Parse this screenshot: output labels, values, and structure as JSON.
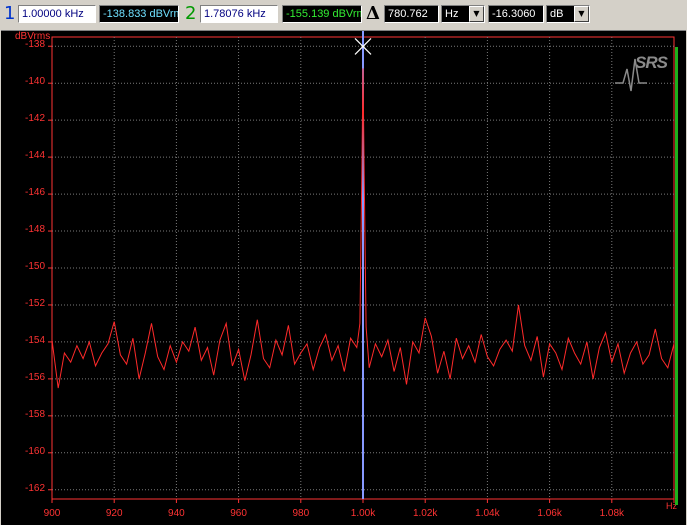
{
  "toolbar": {
    "marker1_number": "1",
    "marker1_freq": "1.00000 kHz",
    "marker1_level": "-138.833 dBVrms",
    "marker2_number": "2",
    "marker2_freq": "1.78076 kHz",
    "marker2_level": "-155.139 dBVrms",
    "delta_symbol": "Δ",
    "delta_freq": "780.762",
    "delta_freq_unit": "Hz",
    "delta_level": "-16.3060",
    "delta_level_unit": "dB",
    "dropdown_icon": "▼"
  },
  "plot": {
    "unit_label": "dBVrms",
    "x_unit_label": "Hz",
    "logo": "SRS",
    "colors": {
      "trace": "#ff2a2a",
      "grid": "#7a7a7a",
      "cursor": "#8899ff",
      "axis_text": "#ff3333",
      "marker2": "#1db11d"
    }
  },
  "chart_data": {
    "type": "line",
    "xlabel": "Hz",
    "ylabel": "dBVrms",
    "xlim": [
      900,
      1100
    ],
    "ylim": [
      -162.5,
      -137.5
    ],
    "x_tick_values": [
      900,
      920,
      940,
      960,
      980,
      1000,
      1020,
      1040,
      1060,
      1080,
      1100
    ],
    "x_tick_labels": [
      "900",
      "920",
      "940",
      "960",
      "980",
      "1.00k",
      "1.02k",
      "1.04k",
      "1.06k",
      "1.08k",
      "Hz"
    ],
    "y_tick_values": [
      -138,
      -140,
      -142,
      -144,
      -146,
      -148,
      -150,
      -152,
      -154,
      -156,
      -158,
      -160,
      -162
    ],
    "y_tick_labels": [
      "-138",
      "-140",
      "-142",
      "-144",
      "-146",
      "-148",
      "-150",
      "-152",
      "-154",
      "-156",
      "-158",
      "-160",
      "-162"
    ],
    "grid": true,
    "cursor_x": 1000,
    "marker1": {
      "x": 1000,
      "y": -139.2
    },
    "series": [
      {
        "x": [
          900,
          902,
          904,
          906,
          908,
          910,
          912,
          914,
          916,
          918,
          920,
          922,
          924,
          926,
          928,
          930,
          932,
          934,
          936,
          938,
          940,
          942,
          944,
          946,
          948,
          950,
          952,
          954,
          956,
          958,
          960,
          962,
          964,
          966,
          968,
          970,
          972,
          974,
          976,
          978,
          980,
          982,
          984,
          986,
          988,
          990,
          992,
          994,
          996,
          998,
          999,
          999.6,
          1000,
          1000.4,
          1001,
          1002,
          1004,
          1006,
          1008,
          1010,
          1012,
          1014,
          1016,
          1018,
          1020,
          1022,
          1024,
          1026,
          1028,
          1030,
          1032,
          1034,
          1036,
          1038,
          1040,
          1042,
          1044,
          1046,
          1048,
          1050,
          1052,
          1054,
          1056,
          1058,
          1060,
          1062,
          1064,
          1066,
          1068,
          1070,
          1072,
          1074,
          1076,
          1078,
          1080,
          1082,
          1084,
          1086,
          1088,
          1090,
          1092,
          1094,
          1096,
          1098,
          1100
        ],
        "y": [
          -153.9,
          -156.5,
          -154.6,
          -155.1,
          -154.2,
          -154.9,
          -154.0,
          -155.3,
          -154.6,
          -154.1,
          -152.9,
          -154.7,
          -155.2,
          -153.8,
          -156.0,
          -154.6,
          -153.0,
          -154.8,
          -155.5,
          -154.2,
          -155.1,
          -154.0,
          -154.5,
          -153.2,
          -155.0,
          -154.3,
          -155.8,
          -153.9,
          -153.0,
          -155.3,
          -154.4,
          -156.1,
          -154.7,
          -152.8,
          -154.9,
          -155.4,
          -153.9,
          -154.7,
          -153.1,
          -155.2,
          -154.6,
          -154.1,
          -155.5,
          -154.3,
          -153.6,
          -155.0,
          -154.2,
          -155.6,
          -153.8,
          -154.3,
          -153.0,
          -145.0,
          -139.2,
          -145.0,
          -153.2,
          -155.4,
          -154.1,
          -154.8,
          -153.9,
          -155.6,
          -154.3,
          -156.3,
          -154.0,
          -154.6,
          -152.7,
          -153.7,
          -155.7,
          -154.5,
          -156.0,
          -153.8,
          -154.9,
          -154.2,
          -155.1,
          -153.6,
          -154.8,
          -155.3,
          -154.4,
          -153.9,
          -154.5,
          -152.0,
          -154.2,
          -155.0,
          -153.7,
          -155.9,
          -154.1,
          -154.6,
          -155.5,
          -153.8,
          -154.6,
          -155.2,
          -154.0,
          -156.0,
          -154.3,
          -153.5,
          -155.1,
          -154.1,
          -155.7,
          -154.6,
          -154.0,
          -155.2,
          -154.7,
          -153.3,
          -154.9,
          -155.4,
          -154.1
        ]
      }
    ]
  }
}
